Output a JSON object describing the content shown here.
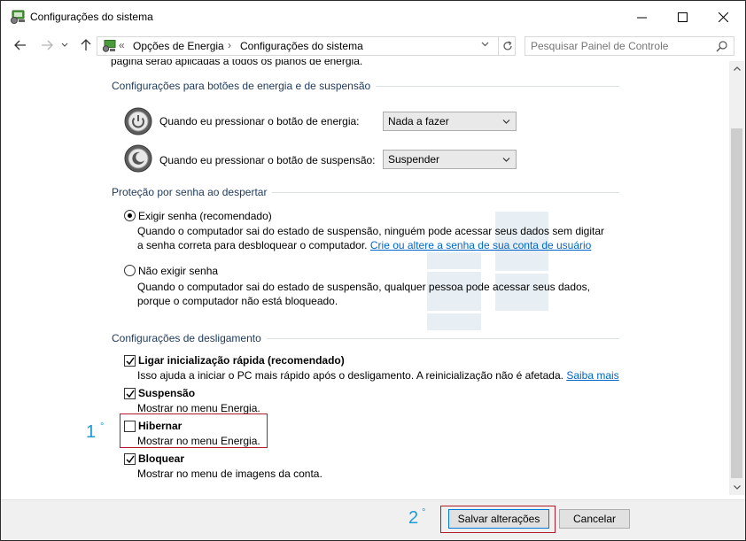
{
  "window": {
    "title": "Configurações do sistema",
    "minimize_label": "—",
    "maximize_label": "☐",
    "close_label": "✕"
  },
  "nav": {
    "back_icon": "arrow-left-icon",
    "forward_icon": "arrow-right-icon",
    "recent_icon": "chevron-down-icon",
    "up_icon": "arrow-up-icon",
    "breadcrumb_prefix": "«",
    "breadcrumb": [
      "Opções de Energia",
      "Configurações do sistema"
    ],
    "breadcrumb_sep": "›",
    "search_placeholder": "Pesquisar Painel de Controle"
  },
  "intro_cut": "página serão aplicadas a todos os planos de energia.",
  "buttons_section": {
    "heading": "Configurações para botões de energia e de suspensão",
    "rows": [
      {
        "label": "Quando eu pressionar o botão de energia:",
        "value": "Nada a fazer",
        "icon": "power-button-icon"
      },
      {
        "label": "Quando eu pressionar o botão de suspensão:",
        "value": "Suspender",
        "icon": "sleep-button-icon"
      }
    ]
  },
  "password_section": {
    "heading": "Proteção por senha ao despertar",
    "require": {
      "label": "Exigir senha (recomendado)",
      "selected": true,
      "desc_line1": "Quando o computador sai do estado de suspensão, ninguém pode acessar seus dados sem digitar",
      "desc_line2": "a senha correta para desbloquear o computador.",
      "link": "Crie ou altere a senha de sua conta de usuário"
    },
    "no_require": {
      "label": "Não exigir senha",
      "selected": false,
      "desc_line1": "Quando o computador sai do estado de suspensão, qualquer pessoa pode acessar seus dados,",
      "desc_line2": "porque o computador não está bloqueado."
    }
  },
  "shutdown_section": {
    "heading": "Configurações de desligamento",
    "items": [
      {
        "label": "Ligar inicialização rápida (recomendado)",
        "checked": true,
        "desc": "Isso ajuda a iniciar o PC mais rápido após o desligamento. A reinicialização não é afetada.",
        "link": "Saiba mais"
      },
      {
        "label": "Suspensão",
        "checked": true,
        "desc": "Mostrar no menu Energia."
      },
      {
        "label": "Hibernar",
        "checked": false,
        "desc": "Mostrar no menu Energia."
      },
      {
        "label": "Bloquear",
        "checked": true,
        "desc": "Mostrar no menu de imagens da conta."
      }
    ]
  },
  "annotations": {
    "step1_num": "1",
    "step2_num": "2",
    "degree": "°",
    "color": "#1e9bd7",
    "box_color": "#b01c2a"
  },
  "footer": {
    "save_label": "Salvar alterações",
    "cancel_label": "Cancelar"
  }
}
